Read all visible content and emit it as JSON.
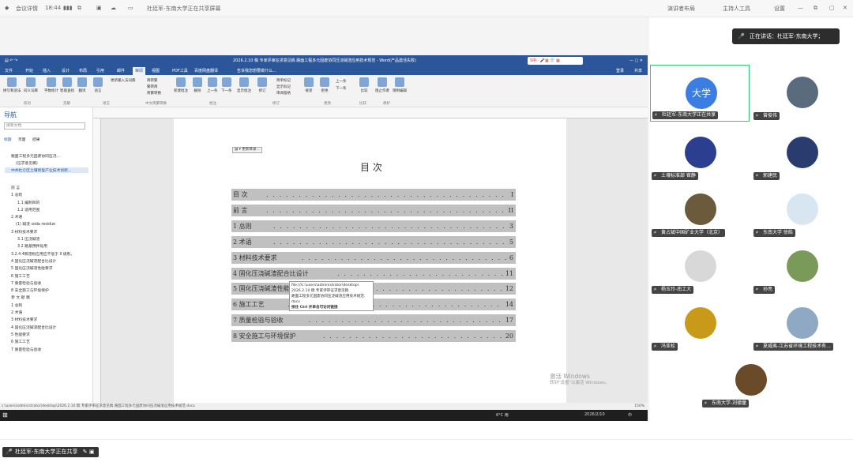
{
  "app": {
    "name": "会议详情",
    "time": "18:44",
    "share_title": "杜廷军-东南大学正在共享屏幕",
    "top_right": {
      "layout": "演讲者布局",
      "host": "主持人工具",
      "settings": "设置"
    }
  },
  "word": {
    "title": "2026.2.10 稿 专家评审征求意见稿 路面工程多元固废协同压浇碱渣应用技术规范 - Word(产品激活失败)",
    "user": "登录",
    "share": "共享",
    "search_placeholder": "告诉我您想要做什么...",
    "tabs": [
      "文件",
      "开始",
      "插入",
      "设计",
      "布局",
      "引用",
      "邮件",
      "审阅",
      "视图",
      "PDF工具",
      "百度网盘翻译"
    ],
    "active_tab": "审阅",
    "ribbon_buttons": [
      {
        "label": "拼写和语法"
      },
      {
        "label": "同义词库"
      },
      {
        "label": "字数统计"
      },
      {
        "label": "智能查找"
      },
      {
        "label": "翻译"
      },
      {
        "label": "语言"
      },
      {
        "label": "新建批注"
      },
      {
        "label": "删除"
      },
      {
        "label": "上一条"
      },
      {
        "label": "下一条"
      },
      {
        "label": "显示批注"
      },
      {
        "label": "修订"
      },
      {
        "label": "接受"
      },
      {
        "label": "拒绝"
      },
      {
        "label": "比较"
      },
      {
        "label": "阻止作者"
      },
      {
        "label": "限制编辑"
      }
    ],
    "ribbon_extras": [
      "更新输入法词典",
      "简转繁",
      "繁转简",
      "简繁转换",
      "简单标记",
      "显示标记",
      "审阅窗格",
      "上一条",
      "下一条"
    ],
    "ribbon_groups": [
      "校对",
      "见解",
      "语言",
      "中文简繁转换",
      "批注",
      "修订",
      "更改",
      "比较",
      "保护"
    ],
    "nav": {
      "title": "导航",
      "search_placeholder": "搜索文档",
      "tabs": [
        "标题",
        "页面",
        "结果"
      ],
      "items": [
        "路面工程多元固废协同压浇...",
        "(征求意见稿)",
        "中共杜仑区土壤修复产业技术创新...",
        "前 言",
        "1 总则",
        "1.1 编制目的",
        "1.2 适用范围",
        "2 术语",
        "(1) 碱渣 soda residue",
        "3 材料技术要求",
        "3.1 压浇碱渣",
        "3.2 路基预拌处用",
        "3.2.4.4钢渣粉应用应不低于 II 级别。",
        "4 固化压浇碱渣配合比设计",
        "5 固化压浇碱渣性能要求",
        "6 施工工艺",
        "7 质量检验与验收",
        "8 安全施工与环境保护",
        "参 文 献 稿",
        "1 总则",
        "2 术语",
        "3 材料技术要求",
        "4 固化压浇碱渣配合比设计",
        "5 性能要求",
        "6 施工工艺",
        "7 质量检验与验收"
      ]
    },
    "toc": {
      "update_button": "更新目录...",
      "heading": "目  次",
      "rows": [
        {
          "title": "目  次",
          "page": "I"
        },
        {
          "title": "前  言",
          "page": "II"
        },
        {
          "title": "1  总则",
          "page": "3"
        },
        {
          "title": "2  术语",
          "page": "5"
        },
        {
          "title": "3  材料技术要求",
          "page": "6"
        },
        {
          "title": "4  固化压浇碱渣配合比设计",
          "page": "11"
        },
        {
          "title": "5  固化压浇碱渣性能要求",
          "page": "12"
        },
        {
          "title": "6  施工工艺",
          "page": "14"
        },
        {
          "title": "7  质量检验与验收",
          "page": "17"
        },
        {
          "title": "8  安全施工与环境保护",
          "page": "20"
        }
      ]
    },
    "tooltip": {
      "line1": "file:///c:\\users\\administrator\\desktop\\",
      "line2": "2026.2.10 稿 专家评审征求意见稿",
      "line3": "路面工程多元固废协同压浇碱渣应用技术规范.",
      "line4": "docx",
      "line5": "按住 Ctrl 并单击可访问链接"
    },
    "status": "c:\\users\\administrator\\desktop\\2026.2.10 稿 专家评审征求意见稿 路面工程多元固废协同压浇碱渣应用技术规范.docx",
    "zoom": "150%",
    "taskbar": {
      "weather": "6°C 雨",
      "date": "2026/2/10",
      "lang": "中"
    },
    "watermark": {
      "line1": "激活 Windows",
      "line2": "转到\"设置\"以激活 Windows。"
    }
  },
  "speaking": "正在讲话：杜廷军-东南大学；",
  "participants": [
    {
      "name": "杜廷军-东南大学正在共享",
      "avatar_text": "大学",
      "color": "#3b7de0"
    },
    {
      "name": "曾俊伟",
      "avatar_text": "",
      "color": "#5a6b7d"
    },
    {
      "name": "土壤标准部 崔静",
      "avatar_text": "",
      "color": "#2c3e8f"
    },
    {
      "name": "郭建民",
      "avatar_text": "",
      "color": "#2a3c6f"
    },
    {
      "name": "黄占斌中国矿业大学（北京）",
      "avatar_text": "",
      "color": "#6b5a3c"
    },
    {
      "name": "东南大学 徐皓",
      "avatar_text": "",
      "color": "#d7e6f0"
    },
    {
      "name": "杨玉玲-南工大",
      "avatar_text": "",
      "color": "#d8d8d8"
    },
    {
      "name": "孙亮",
      "avatar_text": "",
      "color": "#7a9a5a"
    },
    {
      "name": "冯亚松",
      "avatar_text": "",
      "color": "#c99a1a"
    },
    {
      "name": "夏威夷-江苏省环境工程技术有...",
      "avatar_text": "",
      "color": "#8fa8c4"
    },
    {
      "name": "东南大学-刘德量",
      "avatar_text": "",
      "color": "#6b4a2a"
    }
  ],
  "status_chip": "杜廷军-东南大学正在共享"
}
